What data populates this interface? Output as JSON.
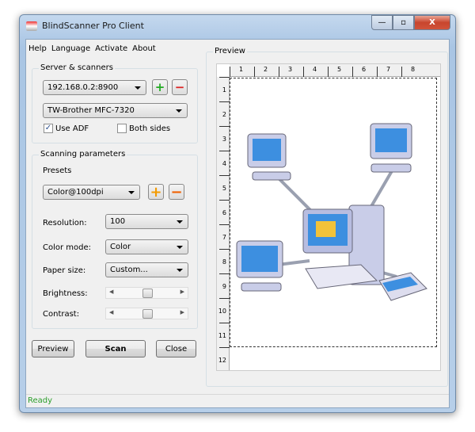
{
  "window": {
    "title": "BlindScanner Pro Client",
    "close": "X"
  },
  "menu": [
    "Help",
    "Language",
    "Activate",
    "About"
  ],
  "server": {
    "label": "Server & scanners",
    "address": "192.168.0.2:8900",
    "scanner": "TW-Brother MFC-7320",
    "use_adf": {
      "label": "Use ADF",
      "checked": true
    },
    "both_sides": {
      "label": "Both sides",
      "checked": false
    }
  },
  "params": {
    "label": "Scanning parameters",
    "presets_label": "Presets",
    "preset": "Color@100dpi",
    "resolution": {
      "label": "Resolution:",
      "value": "100"
    },
    "color_mode": {
      "label": "Color mode:",
      "value": "Color"
    },
    "paper_size": {
      "label": "Paper size:",
      "value": "Custom..."
    },
    "brightness": {
      "label": "Brightness:",
      "value": 0.5
    },
    "contrast": {
      "label": "Contrast:",
      "value": 0.5
    }
  },
  "buttons": {
    "preview": "Preview",
    "scan": "Scan",
    "close": "Close"
  },
  "preview": {
    "label": "Preview",
    "ruler_top": [
      "1",
      "2",
      "3",
      "4",
      "5",
      "6",
      "7",
      "8"
    ],
    "ruler_left": [
      "1",
      "2",
      "3",
      "4",
      "5",
      "6",
      "7",
      "8",
      "9",
      "10",
      "11",
      "12"
    ]
  },
  "status": "Ready"
}
